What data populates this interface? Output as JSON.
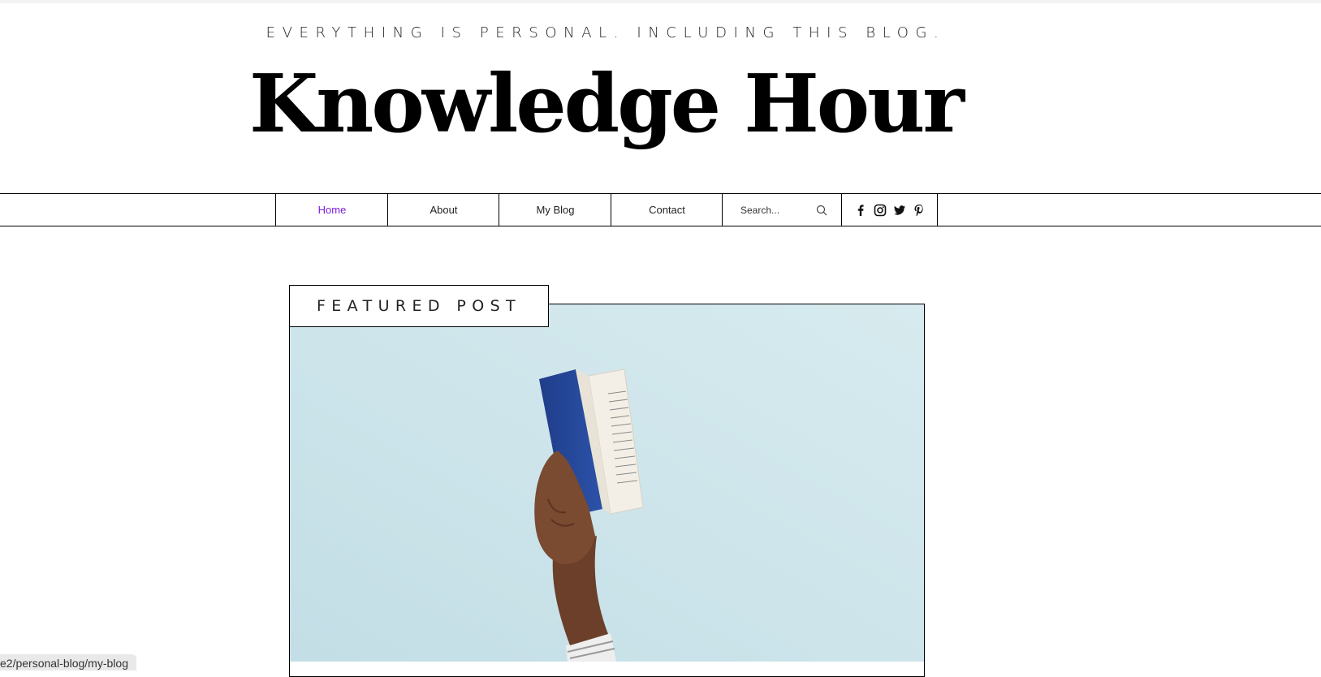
{
  "header": {
    "tagline": "EVERYTHING IS PERSONAL. INCLUDING THIS BLOG.",
    "title": "Knowledge Hour"
  },
  "nav": {
    "items": [
      {
        "label": "Home",
        "active": true
      },
      {
        "label": "About",
        "active": false
      },
      {
        "label": "My Blog",
        "active": false
      },
      {
        "label": "Contact",
        "active": false
      }
    ],
    "active_color": "#7a1de0",
    "search_placeholder": "Search...",
    "social_icons": [
      "facebook-icon",
      "instagram-icon",
      "twitter-icon",
      "pinterest-icon"
    ]
  },
  "featured": {
    "label": "FEATURED POST",
    "image_bg": "#cde4ea"
  },
  "status_bar": {
    "url": "e2/personal-blog/my-blog"
  }
}
